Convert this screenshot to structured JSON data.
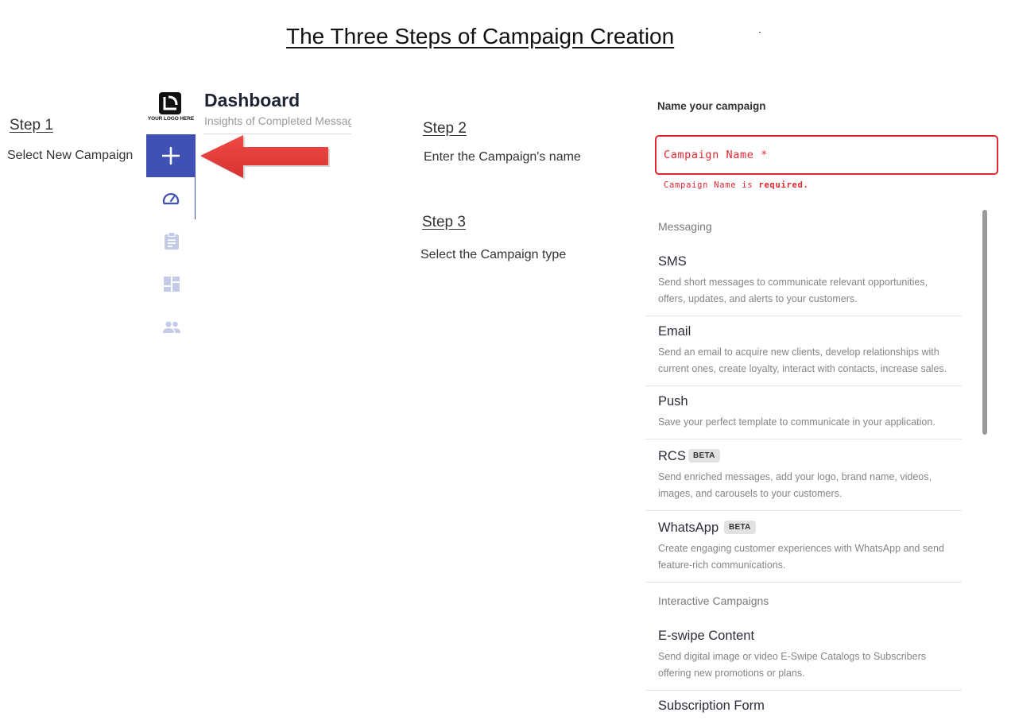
{
  "page": {
    "title": "The Three Steps of Campaign Creation"
  },
  "steps": [
    {
      "heading": "Step 1",
      "text": "Select New Campaign"
    },
    {
      "heading": "Step 2",
      "text": "Enter the Campaign's name"
    },
    {
      "heading": "Step 3",
      "text": "Select the Campaign type"
    }
  ],
  "dashboard": {
    "logo_text": "YOUR LOGO HERE",
    "title": "Dashboard",
    "subtitle": "Insights of Completed Messages",
    "nav_icons": [
      "plus-icon",
      "speedometer-icon",
      "clipboard-icon",
      "dashboard-icon",
      "people-icon"
    ],
    "accent_color": "#3f51b5",
    "inactive_icon_color": "#c5cae9"
  },
  "annotation": {
    "arrow_color": "#e53935"
  },
  "form": {
    "label": "Name your campaign",
    "name_placeholder": "Campaign Name *",
    "error_prefix": "Campaign Name is ",
    "error_emphasis": "required.",
    "error_color": "#e0262f"
  },
  "campaign_groups": [
    {
      "header": "Messaging",
      "items": [
        {
          "name": "SMS",
          "desc_lines": [
            "Send short messages to communicate relevant opportunities,",
            "offers, updates, and alerts to your customers."
          ]
        },
        {
          "name": "Email",
          "desc_lines": [
            "Send an email to acquire new clients, develop relationships with",
            "current ones, create loyalty, interact with contacts, increase sales."
          ]
        },
        {
          "name": "Push",
          "desc_lines": [
            "Save your perfect template to communicate in your application."
          ]
        },
        {
          "name": "RCS",
          "badge": "BETA",
          "desc_lines": [
            "Send enriched messages, add your logo, brand name, videos,",
            "images, and carousels to your customers."
          ]
        },
        {
          "name": "WhatsApp",
          "badge": "BETA",
          "desc_lines": [
            "Create engaging customer experiences with WhatsApp and send",
            "feature-rich communications."
          ]
        }
      ]
    },
    {
      "header": "Interactive Campaigns",
      "items": [
        {
          "name": "E-swipe Content",
          "desc_lines": [
            "Send digital image or video E-Swipe Catalogs to Subscribers",
            "offering new promotions or plans."
          ]
        },
        {
          "name": "Subscription Form",
          "desc_lines": []
        }
      ]
    }
  ]
}
